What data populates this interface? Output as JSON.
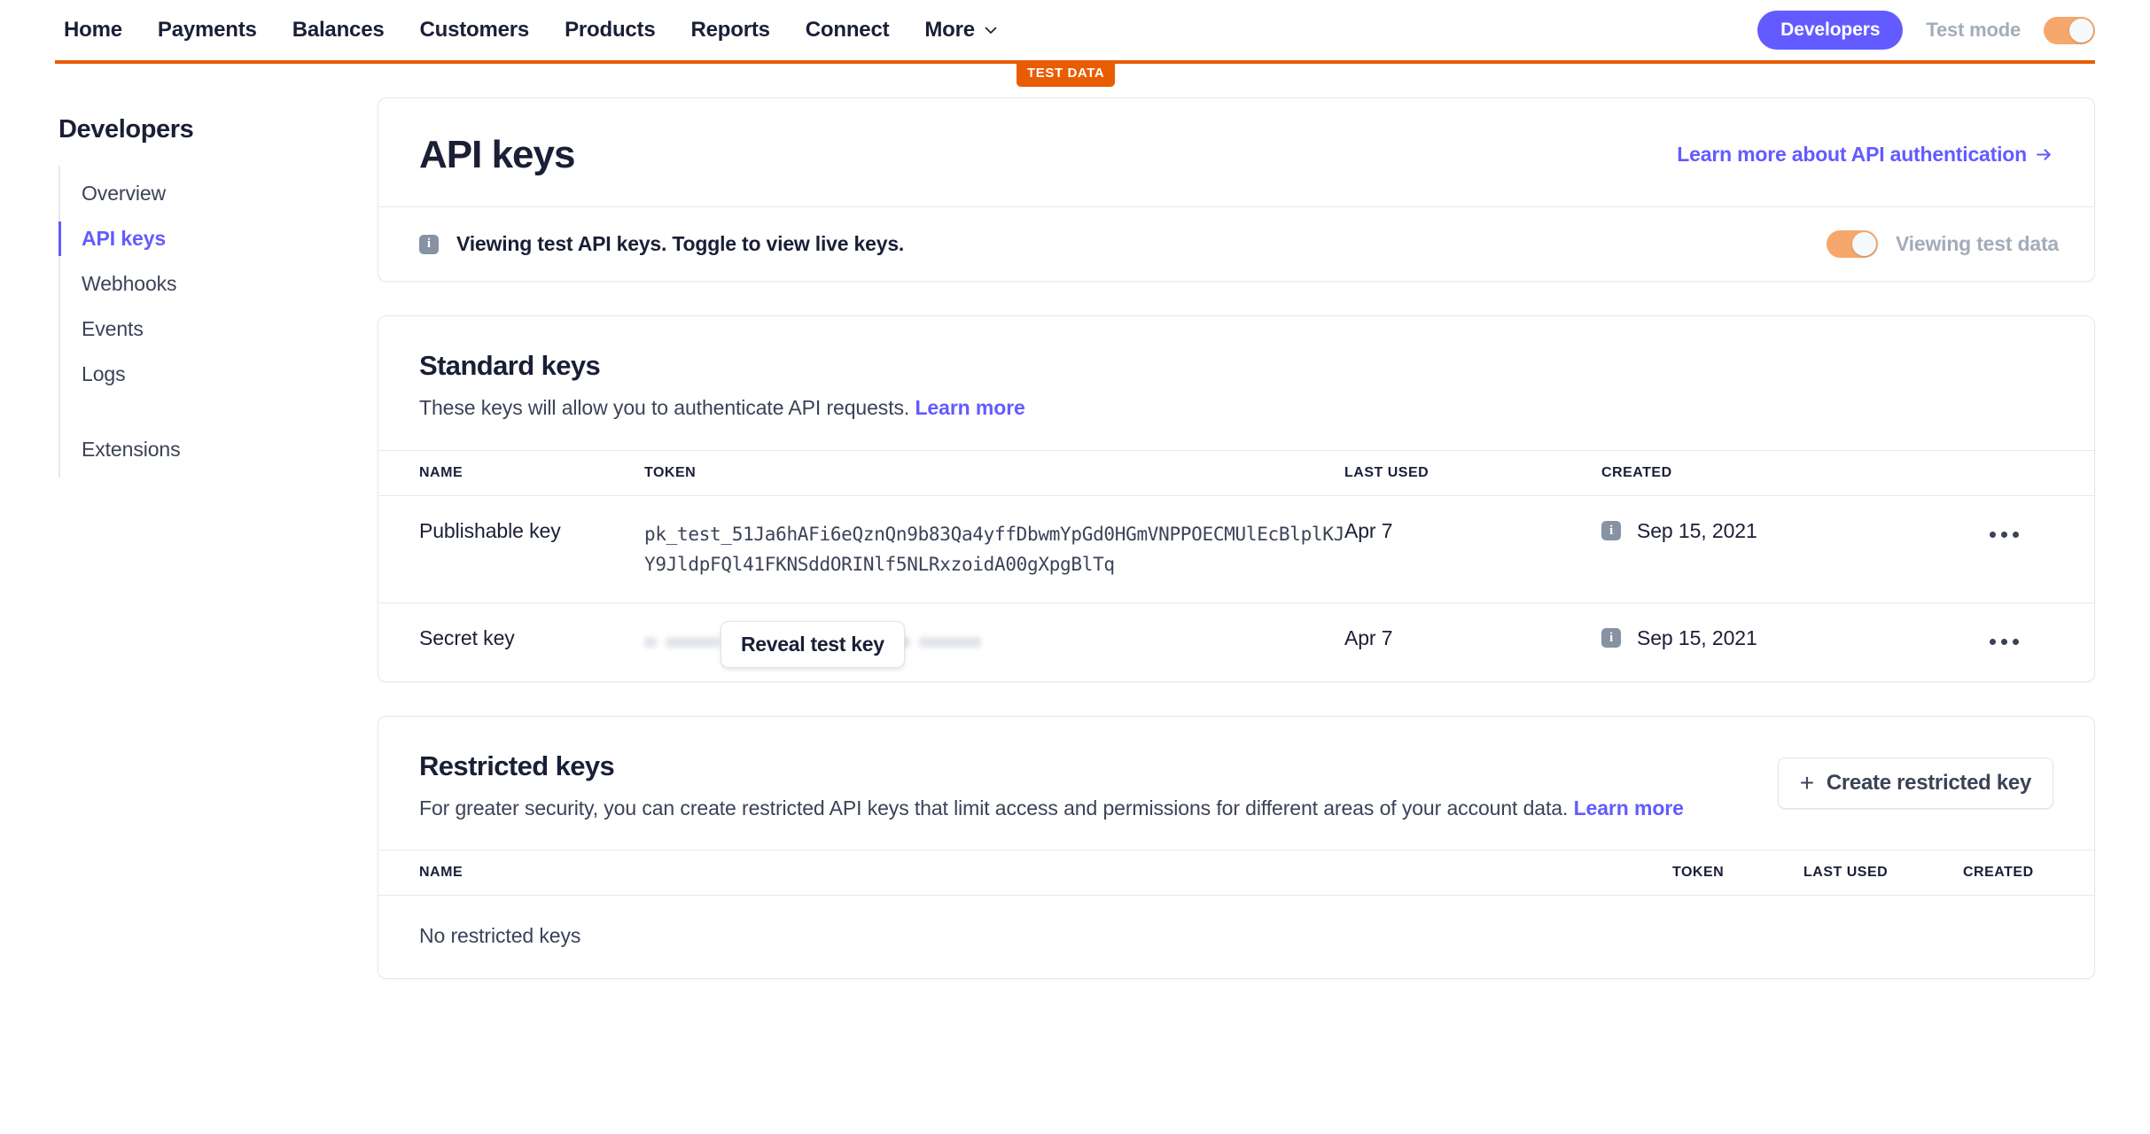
{
  "topnav": {
    "links": [
      "Home",
      "Payments",
      "Balances",
      "Customers",
      "Products",
      "Reports",
      "Connect"
    ],
    "more_label": "More",
    "more_icon": "chevron-down-icon",
    "developers_label": "Developers",
    "test_mode_label": "Test mode",
    "test_mode_on": true,
    "accent_purple": "#635BFF",
    "accent_orange": "#F5A76C"
  },
  "test_bar": {
    "badge_label": "TEST DATA",
    "color": "#E85D04"
  },
  "sidebar": {
    "title": "Developers",
    "items": [
      {
        "label": "Overview",
        "active": false
      },
      {
        "label": "API keys",
        "active": true
      },
      {
        "label": "Webhooks",
        "active": false
      },
      {
        "label": "Events",
        "active": false
      },
      {
        "label": "Logs",
        "active": false
      }
    ],
    "extra_items": [
      {
        "label": "Extensions",
        "active": false
      }
    ]
  },
  "header_card": {
    "title": "API keys",
    "learn_link": "Learn more about API authentication",
    "learn_link_icon": "arrow-right-icon",
    "notice": {
      "icon": "info-icon",
      "text": "Viewing test API keys. Toggle to view live keys.",
      "toggle_label": "Viewing test data",
      "toggle_on": true
    }
  },
  "standard_keys": {
    "title": "Standard keys",
    "description": "These keys will allow you to authenticate API requests.",
    "learn_more": "Learn more",
    "columns": [
      "NAME",
      "TOKEN",
      "LAST USED",
      "CREATED"
    ],
    "rows": [
      {
        "name": "Publishable key",
        "token": "pk_test_51Ja6hAFi6eQznQn9b83Qa4yffDbwmYpGd0HGmVNPPOECMUlEcBlplKJY9JldpFQl41FKNSddORINlf5NLRxzoidA00gXpgBlTq",
        "token_hidden": false,
        "last_used": "Apr 7",
        "created": "Sep 15, 2021",
        "created_icon": "info-icon",
        "menu_icon": "overflow-menu-icon"
      },
      {
        "name": "Secret key",
        "token": "",
        "token_hidden": true,
        "reveal_label": "Reveal test key",
        "last_used": "Apr 7",
        "created": "Sep 15, 2021",
        "created_icon": "info-icon",
        "menu_icon": "overflow-menu-icon"
      }
    ]
  },
  "restricted_keys": {
    "title": "Restricted keys",
    "description": "For greater security, you can create restricted API keys that limit access and permissions for different areas of your account data.",
    "learn_more": "Learn more",
    "create_button": "Create restricted key",
    "create_button_icon": "plus-icon",
    "columns": [
      "NAME",
      "TOKEN",
      "LAST USED",
      "CREATED"
    ],
    "empty_text": "No restricted keys"
  }
}
